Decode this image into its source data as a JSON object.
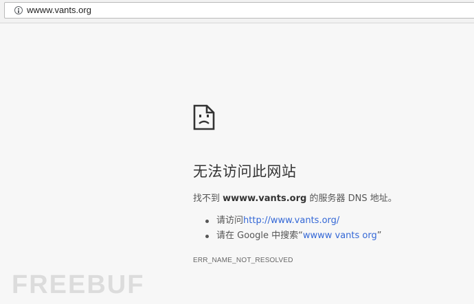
{
  "address_bar": {
    "url": "wwww.vants.org"
  },
  "error_page": {
    "icon": "sad-page-icon",
    "heading": "无法访问此网站",
    "summary_prefix": "找不到 ",
    "summary_host": "wwww.vants.org",
    "summary_suffix": " 的服务器 DNS 地址。",
    "suggestions": [
      {
        "prefix": "请访问",
        "link": "http://www.vants.org/",
        "suffix": ""
      },
      {
        "prefix": "请在 Google 中搜索“",
        "link": "wwww vants org",
        "suffix": "”"
      }
    ],
    "error_code": "ERR_NAME_NOT_RESOLVED"
  },
  "watermark": {
    "text": "FREEBUF"
  }
}
